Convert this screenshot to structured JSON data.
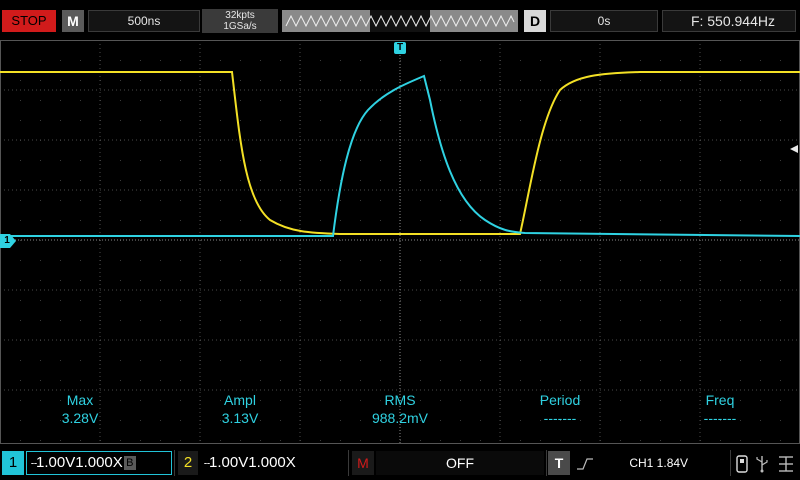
{
  "topbar": {
    "run_state": "STOP",
    "mode_label": "M",
    "timebase": "500ns",
    "memory_depth": "32kpts",
    "sample_rate": "1GSa/s",
    "delay_label": "D",
    "delay_value": "0s",
    "frequency": "F: 550.944Hz"
  },
  "markers": {
    "trigger_marker": "T",
    "ch1_marker": "1"
  },
  "measurements": [
    {
      "name": "Max",
      "value": "3.28V"
    },
    {
      "name": "Ampl",
      "value": "3.13V"
    },
    {
      "name": "RMS",
      "value": "988.2mV"
    },
    {
      "name": "Period",
      "value": "-------"
    },
    {
      "name": "Freq",
      "value": "-------"
    }
  ],
  "bottombar": {
    "ch1": {
      "number": "1",
      "scale": "1.00V",
      "probe": "1.000X",
      "bw_label": "B"
    },
    "ch2": {
      "number": "2",
      "scale": "1.00V",
      "probe": "1.000X"
    },
    "math": {
      "number": "M",
      "state": "OFF"
    },
    "trigger": {
      "label": "T",
      "slope_symbol": "⎍",
      "source_level": "CH1 1.84V"
    }
  },
  "colors": {
    "ch1_trace": "#2fd2e2",
    "ch2_trace": "#f3e025",
    "stop": "#d11b1b",
    "grid": "#606060"
  },
  "icons": [
    "usb-icon",
    "network-icon"
  ]
}
